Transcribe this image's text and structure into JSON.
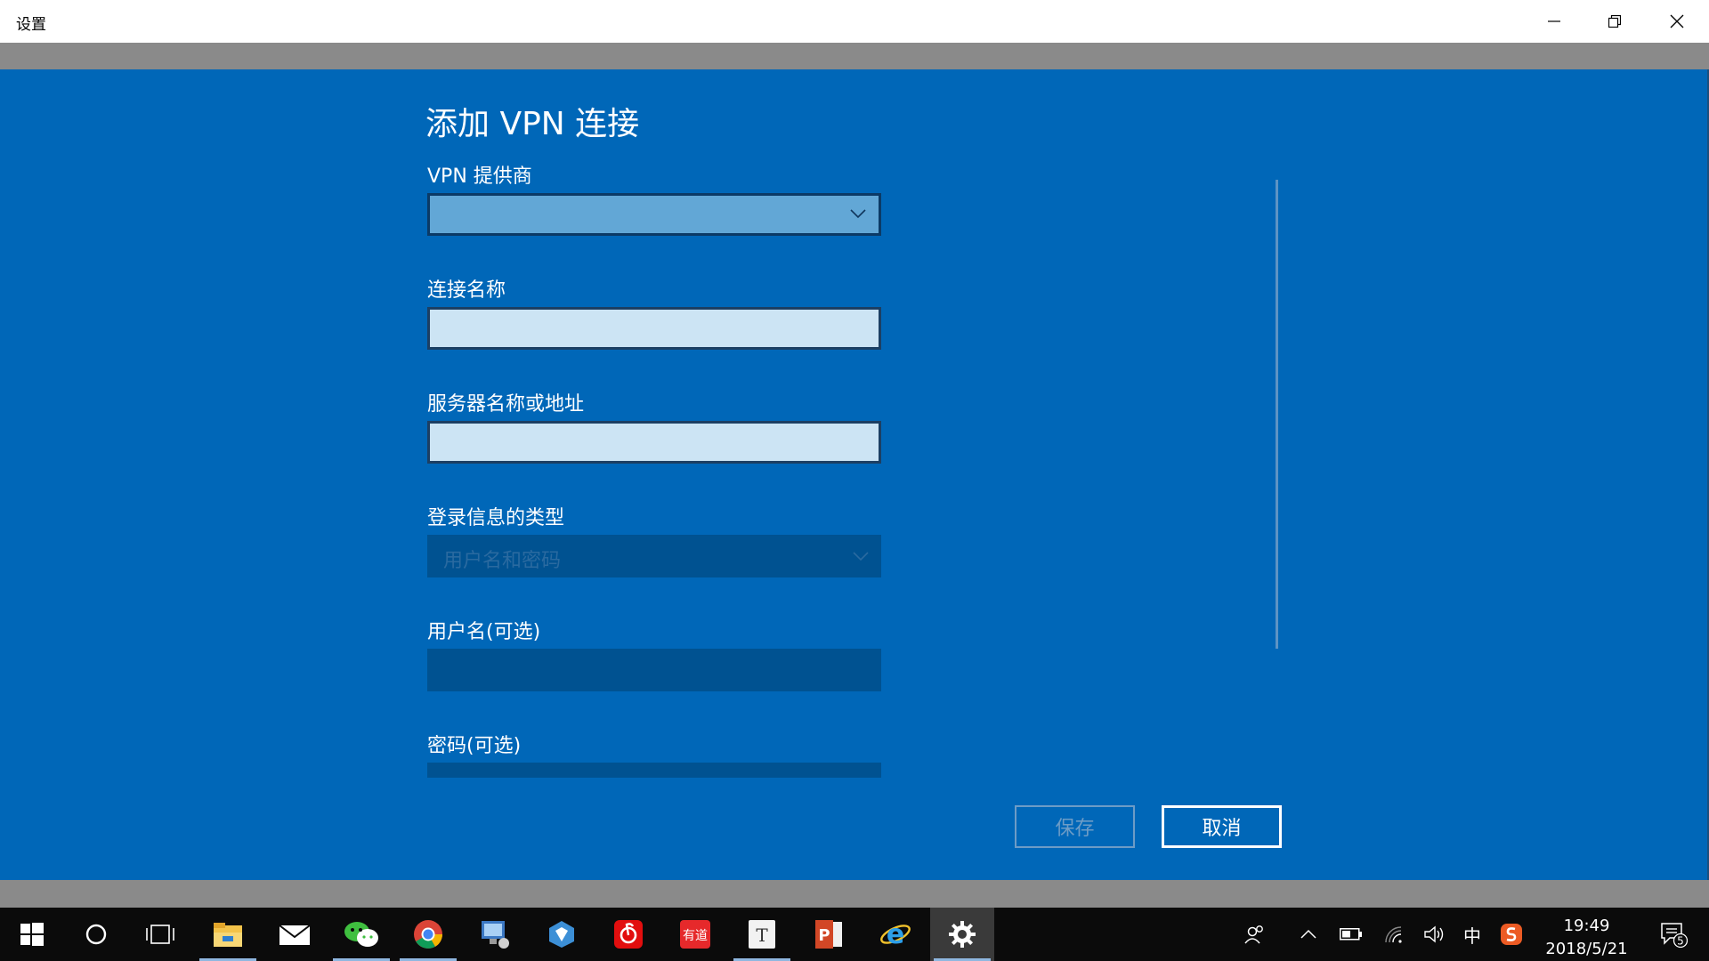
{
  "window": {
    "title": "设置"
  },
  "form": {
    "heading": "添加 VPN 连接",
    "vpn_provider": {
      "label": "VPN 提供商",
      "value": ""
    },
    "connection_name": {
      "label": "连接名称",
      "value": ""
    },
    "server_address": {
      "label": "服务器名称或地址",
      "value": ""
    },
    "signin_type": {
      "label": "登录信息的类型",
      "value": "用户名和密码"
    },
    "username": {
      "label": "用户名(可选)",
      "value": ""
    },
    "password": {
      "label": "密码(可选)",
      "value": ""
    }
  },
  "buttons": {
    "save": "保存",
    "cancel": "取消"
  },
  "taskbar": {
    "apps": [
      {
        "name": "file-explorer-icon"
      },
      {
        "name": "mail-icon"
      },
      {
        "name": "wechat-icon"
      },
      {
        "name": "chrome-icon"
      },
      {
        "name": "remote-desktop-icon"
      },
      {
        "name": "cube-app-icon"
      },
      {
        "name": "netease-music-icon"
      },
      {
        "name": "youdao-icon",
        "text": "有道"
      },
      {
        "name": "typora-icon",
        "text": "T"
      },
      {
        "name": "powerpoint-icon",
        "text": "P"
      },
      {
        "name": "internet-explorer-icon",
        "text": "e"
      },
      {
        "name": "settings-icon"
      }
    ],
    "tray": {
      "ime": "中",
      "time": "19:49",
      "date": "2018/5/21",
      "notifications": "5"
    }
  },
  "colors": {
    "accent": "#0067b8",
    "taskbar": "#0b0b0b"
  }
}
